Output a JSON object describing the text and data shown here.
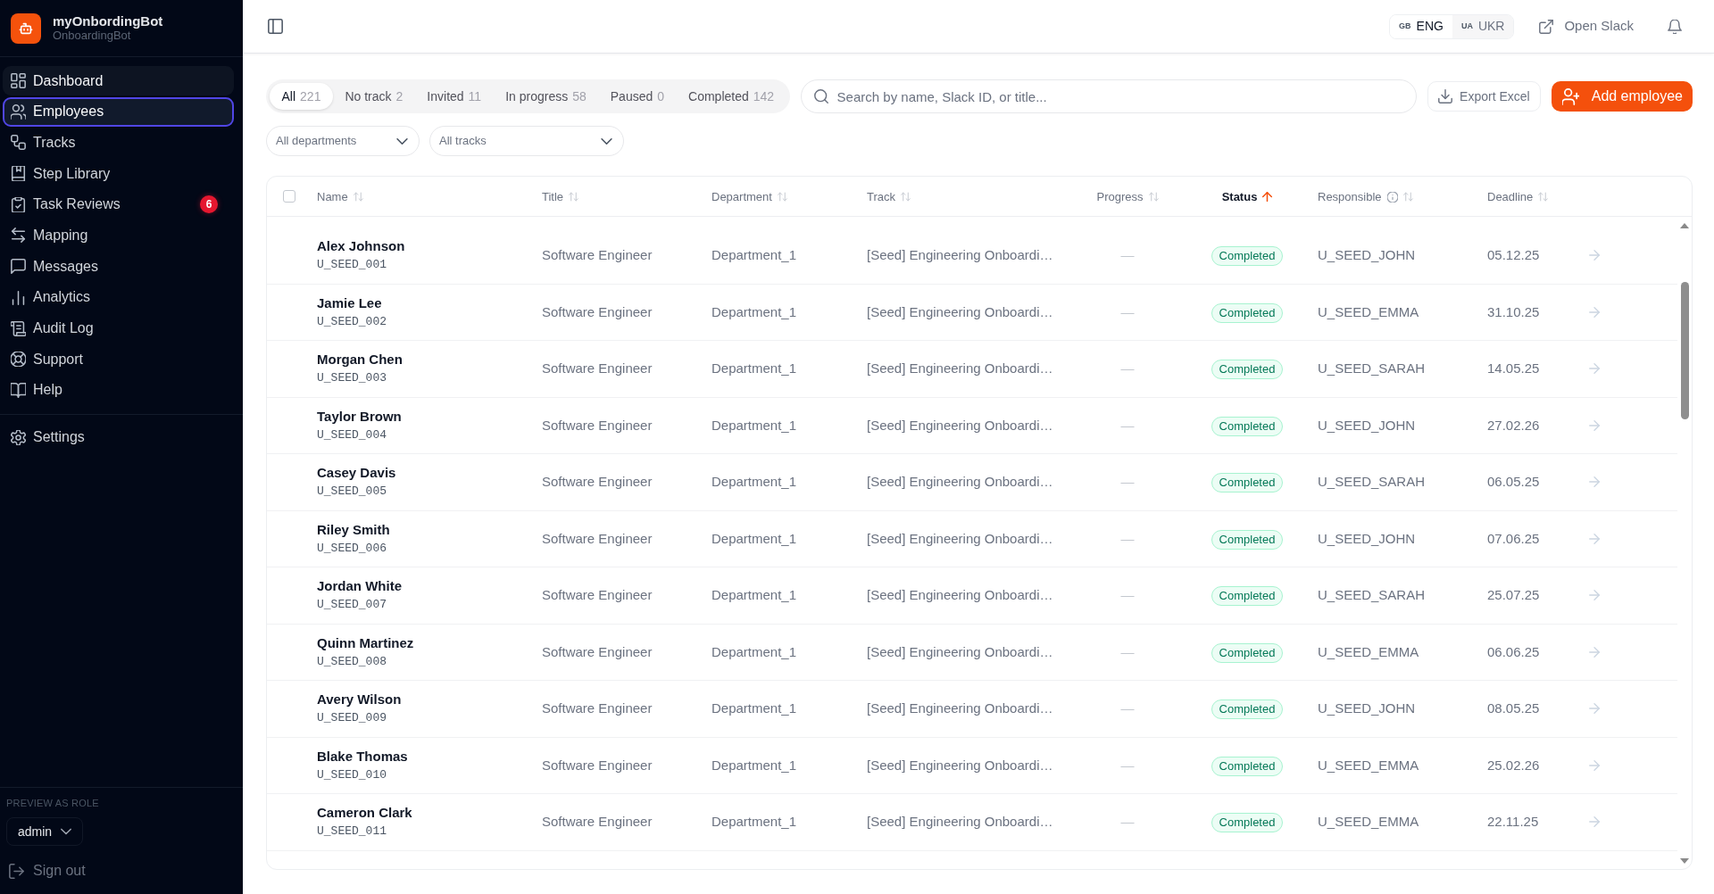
{
  "app": {
    "name": "myOnbordingBot",
    "subtitle": "OnboardingBot"
  },
  "sidebar": {
    "items": [
      {
        "label": "Dashboard",
        "selected": false,
        "hovered": true
      },
      {
        "label": "Employees",
        "selected": true,
        "hovered": false
      },
      {
        "label": "Tracks",
        "selected": false,
        "hovered": false
      },
      {
        "label": "Step Library",
        "selected": false,
        "hovered": false
      },
      {
        "label": "Task Reviews",
        "selected": false,
        "hovered": false,
        "badge": "6"
      },
      {
        "label": "Mapping",
        "selected": false,
        "hovered": false
      },
      {
        "label": "Messages",
        "selected": false,
        "hovered": false
      },
      {
        "label": "Analytics",
        "selected": false,
        "hovered": false
      },
      {
        "label": "Audit Log",
        "selected": false,
        "hovered": false
      },
      {
        "label": "Support",
        "selected": false,
        "hovered": false
      },
      {
        "label": "Help",
        "selected": false,
        "hovered": false
      }
    ],
    "secondary_items": [
      {
        "label": "Settings",
        "selected": false,
        "hovered": false
      }
    ],
    "preview_role": {
      "label": "PREVIEW AS ROLE",
      "value": "admin"
    },
    "sign_out": "Sign out"
  },
  "topbar": {
    "languages": [
      {
        "code": "GB",
        "label": "ENG",
        "selected": true
      },
      {
        "code": "UA",
        "label": "UKR",
        "selected": false
      }
    ],
    "open_slack": "Open Slack"
  },
  "status_tabs": [
    {
      "label": "All",
      "count": "221",
      "selected": true
    },
    {
      "label": "No track",
      "count": "2",
      "selected": false
    },
    {
      "label": "Invited",
      "count": "11",
      "selected": false
    },
    {
      "label": "In progress",
      "count": "58",
      "selected": false
    },
    {
      "label": "Paused",
      "count": "0",
      "selected": false
    },
    {
      "label": "Completed",
      "count": "142",
      "selected": false
    }
  ],
  "search": {
    "placeholder": "Search by name, Slack ID, or title..."
  },
  "actions": [
    {
      "kind": "secondary",
      "label": "Export Excel"
    },
    {
      "kind": "primary",
      "label": "Add employee"
    }
  ],
  "filters": [
    {
      "value": "All departments"
    },
    {
      "value": "All tracks"
    }
  ],
  "table": {
    "select_all": {
      "checked": false
    },
    "columns": [
      {
        "label": "Name",
        "sorted": false
      },
      {
        "label": "Title",
        "sorted": false
      },
      {
        "label": "Department",
        "sorted": false
      },
      {
        "label": "Track",
        "sorted": false
      },
      {
        "label": "Progress",
        "sorted": false
      },
      {
        "label": "Status",
        "sorted": true
      },
      {
        "label": "Responsible",
        "sorted": false,
        "info": true
      },
      {
        "label": "Deadline",
        "sorted": false
      }
    ],
    "rows": [
      {
        "name": "Alex Johnson",
        "slack_id": "U_SEED_001",
        "title": "Software Engineer",
        "department": "Department_1",
        "track": "[Seed] Engineering Onboardi…",
        "progress": "—",
        "status": "Completed",
        "responsible": "U_SEED_JOHN",
        "deadline": "05.12.25"
      },
      {
        "name": "Jamie Lee",
        "slack_id": "U_SEED_002",
        "title": "Software Engineer",
        "department": "Department_1",
        "track": "[Seed] Engineering Onboardi…",
        "progress": "—",
        "status": "Completed",
        "responsible": "U_SEED_EMMA",
        "deadline": "31.10.25"
      },
      {
        "name": "Morgan Chen",
        "slack_id": "U_SEED_003",
        "title": "Software Engineer",
        "department": "Department_1",
        "track": "[Seed] Engineering Onboardi…",
        "progress": "—",
        "status": "Completed",
        "responsible": "U_SEED_SARAH",
        "deadline": "14.05.25"
      },
      {
        "name": "Taylor Brown",
        "slack_id": "U_SEED_004",
        "title": "Software Engineer",
        "department": "Department_1",
        "track": "[Seed] Engineering Onboardi…",
        "progress": "—",
        "status": "Completed",
        "responsible": "U_SEED_JOHN",
        "deadline": "27.02.26"
      },
      {
        "name": "Casey Davis",
        "slack_id": "U_SEED_005",
        "title": "Software Engineer",
        "department": "Department_1",
        "track": "[Seed] Engineering Onboardi…",
        "progress": "—",
        "status": "Completed",
        "responsible": "U_SEED_SARAH",
        "deadline": "06.05.25"
      },
      {
        "name": "Riley Smith",
        "slack_id": "U_SEED_006",
        "title": "Software Engineer",
        "department": "Department_1",
        "track": "[Seed] Engineering Onboardi…",
        "progress": "—",
        "status": "Completed",
        "responsible": "U_SEED_JOHN",
        "deadline": "07.06.25"
      },
      {
        "name": "Jordan White",
        "slack_id": "U_SEED_007",
        "title": "Software Engineer",
        "department": "Department_1",
        "track": "[Seed] Engineering Onboardi…",
        "progress": "—",
        "status": "Completed",
        "responsible": "U_SEED_SARAH",
        "deadline": "25.07.25"
      },
      {
        "name": "Quinn Martinez",
        "slack_id": "U_SEED_008",
        "title": "Software Engineer",
        "department": "Department_1",
        "track": "[Seed] Engineering Onboardi…",
        "progress": "—",
        "status": "Completed",
        "responsible": "U_SEED_EMMA",
        "deadline": "06.06.25"
      },
      {
        "name": "Avery Wilson",
        "slack_id": "U_SEED_009",
        "title": "Software Engineer",
        "department": "Department_1",
        "track": "[Seed] Engineering Onboardi…",
        "progress": "—",
        "status": "Completed",
        "responsible": "U_SEED_JOHN",
        "deadline": "08.05.25"
      },
      {
        "name": "Blake Thomas",
        "slack_id": "U_SEED_010",
        "title": "Software Engineer",
        "department": "Department_1",
        "track": "[Seed] Engineering Onboardi…",
        "progress": "—",
        "status": "Completed",
        "responsible": "U_SEED_EMMA",
        "deadline": "25.02.26"
      },
      {
        "name": "Cameron Clark",
        "slack_id": "U_SEED_011",
        "title": "Software Engineer",
        "department": "Department_1",
        "track": "[Seed] Engineering Onboardi…",
        "progress": "—",
        "status": "Completed",
        "responsible": "U_SEED_EMMA",
        "deadline": "22.11.25"
      }
    ]
  }
}
